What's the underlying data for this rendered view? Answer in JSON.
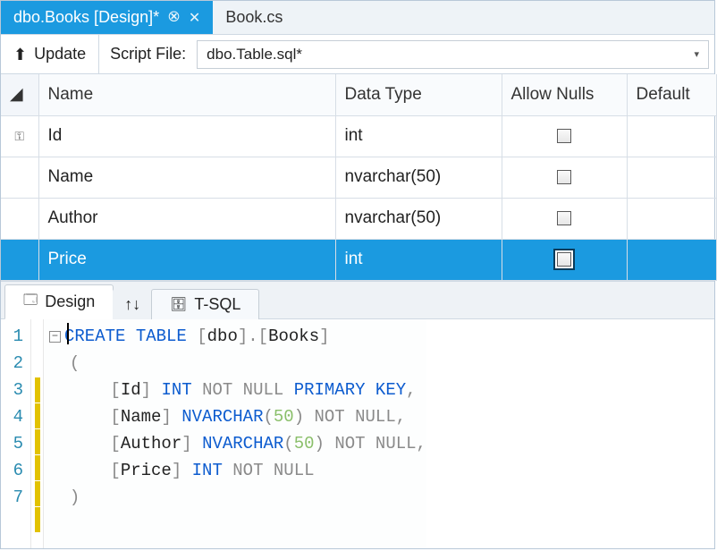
{
  "tabs": {
    "active_label": "dbo.Books [Design]*",
    "inactive_label": "Book.cs"
  },
  "toolbar": {
    "update_label": "Update",
    "script_label": "Script File:",
    "script_file": "dbo.Table.sql*"
  },
  "grid": {
    "headers": {
      "name": "Name",
      "datatype": "Data Type",
      "allownulls": "Allow Nulls",
      "default": "Default"
    },
    "rows": [
      {
        "is_key": true,
        "name": "Id",
        "type": "int",
        "selected": false
      },
      {
        "is_key": false,
        "name": "Name",
        "type": "nvarchar(50)",
        "selected": false
      },
      {
        "is_key": false,
        "name": "Author",
        "type": "nvarchar(50)",
        "selected": false
      },
      {
        "is_key": false,
        "name": "Price",
        "type": "int",
        "selected": true
      }
    ]
  },
  "bottom_tabs": {
    "design": "Design",
    "tsql": "T-SQL"
  },
  "code": {
    "line1_kw1": "CREATE",
    "line1_kw2": "TABLE",
    "line1_schema": "dbo",
    "line1_obj": "Books",
    "line3_col": "Id",
    "line3_type": "INT",
    "line3_notnull": "NOT NULL",
    "line3_pk": "PRIMARY KEY",
    "line4_col": "Name",
    "line4_type": "NVARCHAR",
    "line4_len": "50",
    "line4_notnull": "NOT NULL",
    "line5_col": "Author",
    "line5_type": "NVARCHAR",
    "line5_len": "50",
    "line5_notnull": "NOT NULL",
    "line6_col": "Price",
    "line6_type": "INT",
    "line6_notnull": "NOT NULL"
  }
}
